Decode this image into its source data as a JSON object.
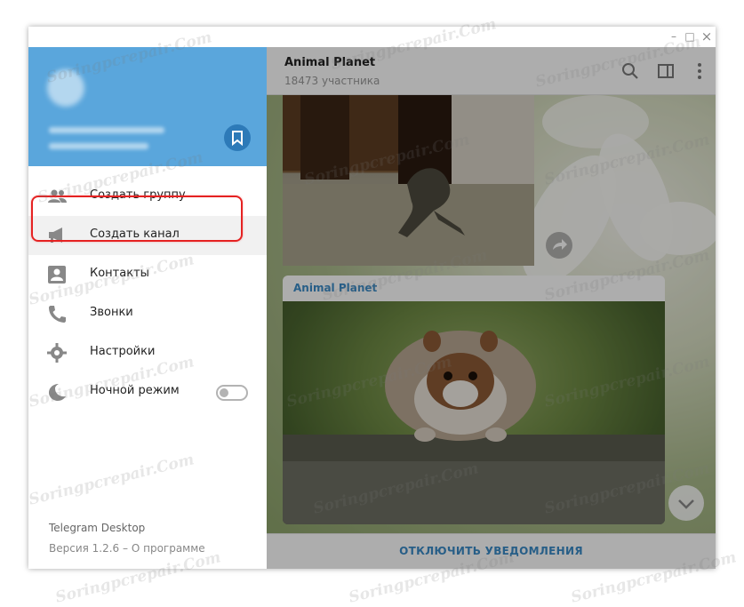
{
  "window_controls": {
    "minimize": "–",
    "maximize": "□",
    "close": "×"
  },
  "chat": {
    "title": "Animal Planet",
    "subtitle": "18473 участника",
    "post_author": "Animal Planet",
    "bottom_action": "ОТКЛЮЧИТЬ УВЕДОМЛЕНИЯ"
  },
  "header_icons": [
    "search-icon",
    "sidebar-toggle-icon",
    "more-vertical-icon"
  ],
  "sidebar": {
    "menu": [
      {
        "label": "Создать группу",
        "icon": "group-icon"
      },
      {
        "label": "Создать канал",
        "icon": "megaphone-icon"
      },
      {
        "label": "Контакты",
        "icon": "contact-icon"
      },
      {
        "label": "Звонки",
        "icon": "phone-icon"
      },
      {
        "label": "Настройки",
        "icon": "gear-icon"
      },
      {
        "label": "Ночной режим",
        "icon": "moon-icon"
      }
    ],
    "night_mode_enabled": false,
    "app_name": "Telegram Desktop",
    "version_text": "Версия 1.2.6",
    "version_sep": " – ",
    "about_link": "О программе"
  },
  "colors": {
    "accent": "#5aa6dc",
    "link": "#3a8bc8",
    "highlight_border": "#e52222"
  },
  "watermark": "Soringpcrepair.Com"
}
